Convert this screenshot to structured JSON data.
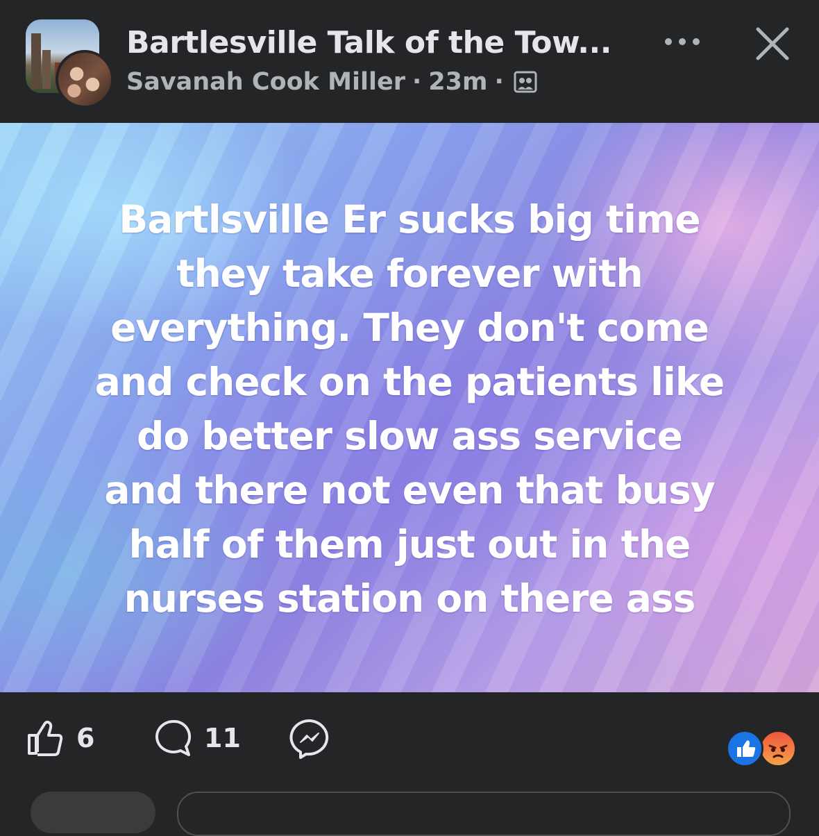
{
  "header": {
    "group_name": "Bartlesville Talk of the Tow...",
    "author": "Savanah Cook Miller",
    "separator": "·",
    "time": "23m",
    "audience_icon": "members-only-icon"
  },
  "post": {
    "lines": [
      "Bartlsville Er sucks big time",
      "they take forever with",
      "everything. They don't come",
      "and check on the patients like",
      "do better slow ass service",
      "and there not even that busy",
      "half of them just out in the",
      "nurses station on there ass"
    ]
  },
  "actions": {
    "like_count": "6",
    "comment_count": "11"
  },
  "colors": {
    "background": "#242526",
    "text_primary": "#e4e6eb",
    "text_secondary": "#b0b3b8",
    "like_blue": "#1b74e4",
    "angry_orange": "#f0553c"
  }
}
